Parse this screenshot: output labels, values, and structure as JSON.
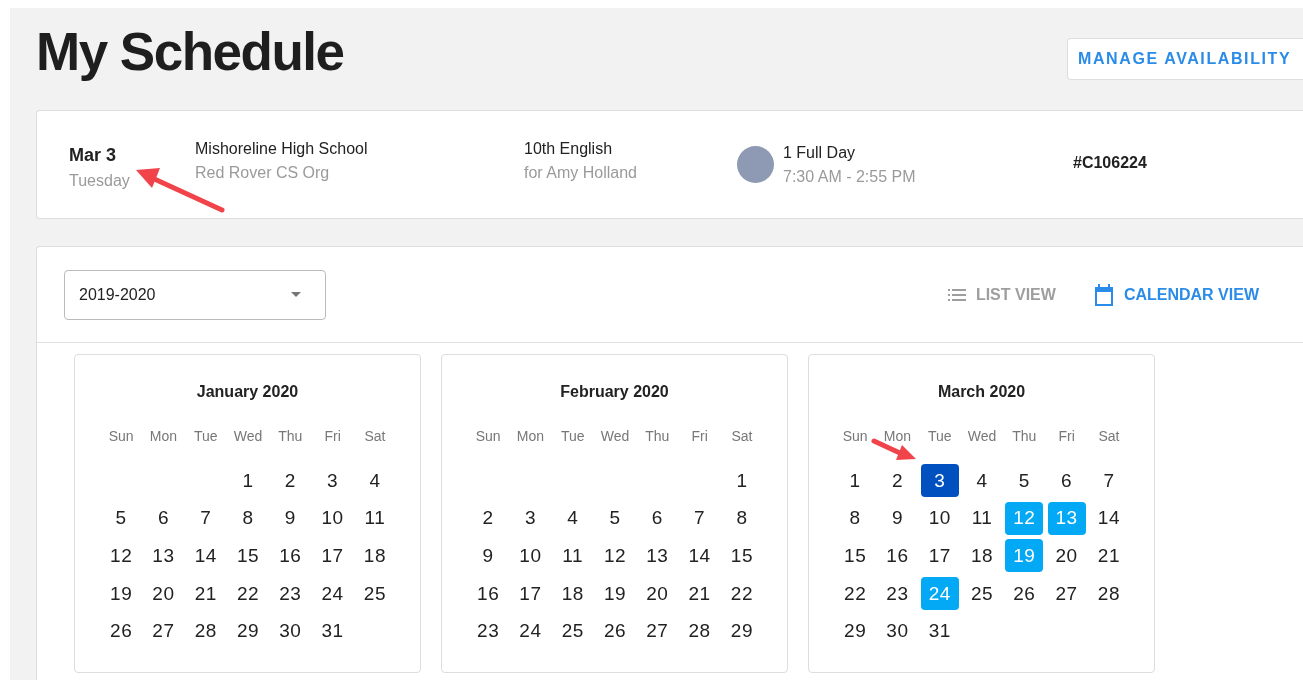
{
  "page": {
    "title": "My Schedule",
    "action": "MANAGE AVAILABILITY"
  },
  "assignment": {
    "date": "Mar 3",
    "weekday": "Tuesday",
    "school": "Mishoreline High School",
    "organization": "Red Rover CS Org",
    "class": "10th English",
    "for": "for Amy Holland",
    "duration": "1 Full Day",
    "hours": "7:30 AM - 2:55 PM",
    "number": "#C106224"
  },
  "toolbar": {
    "school_year": "2019-2020",
    "views": [
      {
        "kind": "list",
        "label": "LIST VIEW",
        "selected": false
      },
      {
        "kind": "calendar",
        "label": "CALENDAR VIEW",
        "selected": true
      }
    ]
  },
  "months": [
    {
      "title": "January 2020",
      "weekdays": [
        "Sun",
        "Mon",
        "Tue",
        "Wed",
        "Thu",
        "Fri",
        "Sat"
      ],
      "weeks": [
        [
          {
            "label": "1",
            "selected": false,
            "booked": false
          },
          {
            "label": "2",
            "selected": false,
            "booked": false
          },
          {
            "label": "3",
            "selected": false,
            "booked": false
          },
          {
            "label": "4",
            "selected": false,
            "booked": false
          }
        ],
        [
          {
            "label": "5",
            "selected": false,
            "booked": false
          },
          {
            "label": "6",
            "selected": false,
            "booked": false
          },
          {
            "label": "7",
            "selected": false,
            "booked": false
          },
          {
            "label": "8",
            "selected": false,
            "booked": false
          },
          {
            "label": "9",
            "selected": false,
            "booked": false
          },
          {
            "label": "10",
            "selected": false,
            "booked": false
          },
          {
            "label": "11",
            "selected": false,
            "booked": false
          }
        ],
        [
          {
            "label": "12",
            "selected": false,
            "booked": false
          },
          {
            "label": "13",
            "selected": false,
            "booked": false
          },
          {
            "label": "14",
            "selected": false,
            "booked": false
          },
          {
            "label": "15",
            "selected": false,
            "booked": false
          },
          {
            "label": "16",
            "selected": false,
            "booked": false
          },
          {
            "label": "17",
            "selected": false,
            "booked": false
          },
          {
            "label": "18",
            "selected": false,
            "booked": false
          }
        ],
        [
          {
            "label": "19",
            "selected": false,
            "booked": false
          },
          {
            "label": "20",
            "selected": false,
            "booked": false
          },
          {
            "label": "21",
            "selected": false,
            "booked": false
          },
          {
            "label": "22",
            "selected": false,
            "booked": false
          },
          {
            "label": "23",
            "selected": false,
            "booked": false
          },
          {
            "label": "24",
            "selected": false,
            "booked": false
          },
          {
            "label": "25",
            "selected": false,
            "booked": false
          }
        ],
        [
          {
            "label": "26",
            "selected": false,
            "booked": false
          },
          {
            "label": "27",
            "selected": false,
            "booked": false
          },
          {
            "label": "28",
            "selected": false,
            "booked": false
          },
          {
            "label": "29",
            "selected": false,
            "booked": false
          },
          {
            "label": "30",
            "selected": false,
            "booked": false
          },
          {
            "label": "31",
            "selected": false,
            "booked": false
          }
        ]
      ]
    },
    {
      "title": "February 2020",
      "weekdays": [
        "Sun",
        "Mon",
        "Tue",
        "Wed",
        "Thu",
        "Fri",
        "Sat"
      ],
      "weeks": [
        [
          {
            "label": "1",
            "selected": false,
            "booked": false
          }
        ],
        [
          {
            "label": "2",
            "selected": false,
            "booked": false
          },
          {
            "label": "3",
            "selected": false,
            "booked": false
          },
          {
            "label": "4",
            "selected": false,
            "booked": false
          },
          {
            "label": "5",
            "selected": false,
            "booked": false
          },
          {
            "label": "6",
            "selected": false,
            "booked": false
          },
          {
            "label": "7",
            "selected": false,
            "booked": false
          },
          {
            "label": "8",
            "selected": false,
            "booked": false
          }
        ],
        [
          {
            "label": "9",
            "selected": false,
            "booked": false
          },
          {
            "label": "10",
            "selected": false,
            "booked": false
          },
          {
            "label": "11",
            "selected": false,
            "booked": false
          },
          {
            "label": "12",
            "selected": false,
            "booked": false
          },
          {
            "label": "13",
            "selected": false,
            "booked": false
          },
          {
            "label": "14",
            "selected": false,
            "booked": false
          },
          {
            "label": "15",
            "selected": false,
            "booked": false
          }
        ],
        [
          {
            "label": "16",
            "selected": false,
            "booked": false
          },
          {
            "label": "17",
            "selected": false,
            "booked": false
          },
          {
            "label": "18",
            "selected": false,
            "booked": false
          },
          {
            "label": "19",
            "selected": false,
            "booked": false
          },
          {
            "label": "20",
            "selected": false,
            "booked": false
          },
          {
            "label": "21",
            "selected": false,
            "booked": false
          },
          {
            "label": "22",
            "selected": false,
            "booked": false
          }
        ],
        [
          {
            "label": "23",
            "selected": false,
            "booked": false
          },
          {
            "label": "24",
            "selected": false,
            "booked": false
          },
          {
            "label": "25",
            "selected": false,
            "booked": false
          },
          {
            "label": "26",
            "selected": false,
            "booked": false
          },
          {
            "label": "27",
            "selected": false,
            "booked": false
          },
          {
            "label": "28",
            "selected": false,
            "booked": false
          },
          {
            "label": "29",
            "selected": false,
            "booked": false
          }
        ]
      ]
    },
    {
      "title": "March 2020",
      "weekdays": [
        "Sun",
        "Mon",
        "Tue",
        "Wed",
        "Thu",
        "Fri",
        "Sat"
      ],
      "weeks": [
        [
          {
            "label": "1",
            "selected": false,
            "booked": false
          },
          {
            "label": "2",
            "selected": false,
            "booked": false
          },
          {
            "label": "3",
            "selected": true,
            "booked": true
          },
          {
            "label": "4",
            "selected": false,
            "booked": false
          },
          {
            "label": "5",
            "selected": false,
            "booked": false
          },
          {
            "label": "6",
            "selected": false,
            "booked": false
          },
          {
            "label": "7",
            "selected": false,
            "booked": false
          }
        ],
        [
          {
            "label": "8",
            "selected": false,
            "booked": false
          },
          {
            "label": "9",
            "selected": false,
            "booked": false
          },
          {
            "label": "10",
            "selected": false,
            "booked": false
          },
          {
            "label": "11",
            "selected": false,
            "booked": false
          },
          {
            "label": "12",
            "selected": false,
            "booked": true
          },
          {
            "label": "13",
            "selected": false,
            "booked": true
          },
          {
            "label": "14",
            "selected": false,
            "booked": false
          }
        ],
        [
          {
            "label": "15",
            "selected": false,
            "booked": false
          },
          {
            "label": "16",
            "selected": false,
            "booked": false
          },
          {
            "label": "17",
            "selected": false,
            "booked": false
          },
          {
            "label": "18",
            "selected": false,
            "booked": false
          },
          {
            "label": "19",
            "selected": false,
            "booked": true
          },
          {
            "label": "20",
            "selected": false,
            "booked": false
          },
          {
            "label": "21",
            "selected": false,
            "booked": false
          }
        ],
        [
          {
            "label": "22",
            "selected": false,
            "booked": false
          },
          {
            "label": "23",
            "selected": false,
            "booked": false
          },
          {
            "label": "24",
            "selected": false,
            "booked": true
          },
          {
            "label": "25",
            "selected": false,
            "booked": false
          },
          {
            "label": "26",
            "selected": false,
            "booked": false
          },
          {
            "label": "27",
            "selected": false,
            "booked": false
          },
          {
            "label": "28",
            "selected": false,
            "booked": false
          }
        ],
        [
          {
            "label": "29",
            "selected": false,
            "booked": false
          },
          {
            "label": "30",
            "selected": false,
            "booked": false
          },
          {
            "label": "31",
            "selected": false,
            "booked": false
          }
        ]
      ]
    }
  ]
}
